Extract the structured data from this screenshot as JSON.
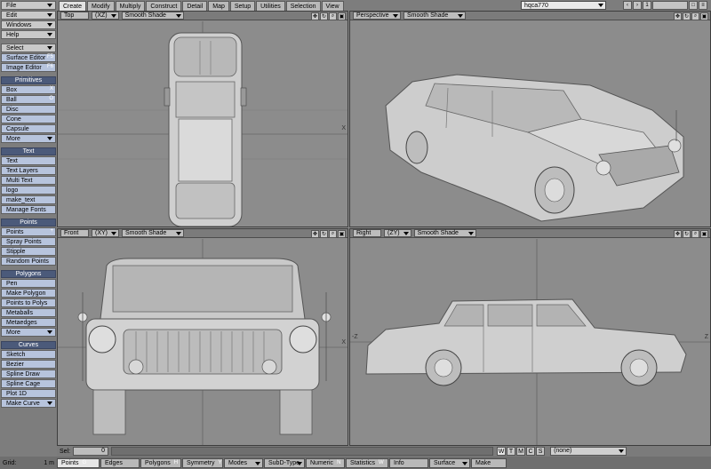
{
  "sidebar": {
    "top": [
      {
        "label": "File",
        "arrow": true
      },
      {
        "label": "Edit",
        "arrow": true
      },
      {
        "label": "Windows",
        "arrow": true
      },
      {
        "label": "Help",
        "arrow": true
      }
    ],
    "select_group": [
      {
        "label": "Select",
        "arrow": true
      },
      {
        "label": "Surface Editor",
        "key": "F5"
      },
      {
        "label": "Image Editor",
        "key": "F6"
      }
    ],
    "primitives": {
      "header": "Primitives",
      "items": [
        {
          "label": "Box",
          "key": "X"
        },
        {
          "label": "Ball",
          "key": "O"
        },
        {
          "label": "Disc"
        },
        {
          "label": "Cone"
        },
        {
          "label": "Capsule"
        },
        {
          "label": "More",
          "arrow": true
        }
      ]
    },
    "text": {
      "header": "Text",
      "items": [
        {
          "label": "Text"
        },
        {
          "label": "Text Layers"
        },
        {
          "label": "Multi Text"
        },
        {
          "label": "logo"
        },
        {
          "label": "make_text"
        },
        {
          "label": "Manage Fonts"
        }
      ]
    },
    "points": {
      "header": "Points",
      "items": [
        {
          "label": "Points",
          "key": "+"
        },
        {
          "label": "Spray Points"
        },
        {
          "label": "Stipple"
        },
        {
          "label": "Random Points"
        }
      ]
    },
    "polygons": {
      "header": "Polygons",
      "items": [
        {
          "label": "Pen"
        },
        {
          "label": "Make Polygon"
        },
        {
          "label": "Points to Polys"
        },
        {
          "label": "Metaballs"
        },
        {
          "label": "Metaedges"
        },
        {
          "label": "More",
          "arrow": true
        }
      ]
    },
    "curves": {
      "header": "Curves",
      "items": [
        {
          "label": "Sketch"
        },
        {
          "label": "Bezier"
        },
        {
          "label": "Spline Draw"
        },
        {
          "label": "Spline Cage"
        },
        {
          "label": "Plot 1D"
        },
        {
          "label": "Make Curve",
          "arrow": true
        }
      ]
    }
  },
  "tabs": [
    "Create",
    "Modify",
    "Multiply",
    "Construct",
    "Detail",
    "Map",
    "Setup",
    "Utilities",
    "Selection",
    "View"
  ],
  "active_tab": "Create",
  "scene_name": "hqca770",
  "viewports": {
    "top": {
      "view": "Top",
      "axes": "(XZ)",
      "shade": "Smooth Shade",
      "axis_x": "X"
    },
    "perspective": {
      "view": "Perspective",
      "shade": "Smooth Shade"
    },
    "front": {
      "view": "Front",
      "axes": "(XY)",
      "shade": "Smooth Shade",
      "axis_x": "X"
    },
    "right": {
      "view": "Right",
      "axes": "(ZY)",
      "shade": "Smooth Shade",
      "axis_x": "-Z",
      "axis_x2": "Z"
    }
  },
  "selbar": {
    "label": "Sel:",
    "value": "0",
    "buttons": [
      "W",
      "T",
      "M",
      "C",
      "S"
    ],
    "layer": "(none)"
  },
  "modebar": {
    "grid_label": "Grid:",
    "grid_value": "1 m",
    "buttons": [
      {
        "label": "Points",
        "key": "G",
        "on": true
      },
      {
        "label": "Edges"
      },
      {
        "label": "Polygons",
        "key": "H"
      },
      {
        "label": "Symmetry",
        "key": "Y"
      },
      {
        "label": "Modes",
        "arrow": true
      },
      {
        "label": "SubD-Type",
        "arrow": true
      },
      {
        "label": "Numeric",
        "key": "N"
      },
      {
        "label": "Statistics",
        "key": "W"
      },
      {
        "label": "Info"
      },
      {
        "label": "Surface",
        "arrow": true
      },
      {
        "label": "Make"
      }
    ]
  },
  "colors": {
    "accent_header": "#4b5a7a",
    "viewport_bg": "#8c8c8c",
    "model": "#d2d2d2"
  }
}
